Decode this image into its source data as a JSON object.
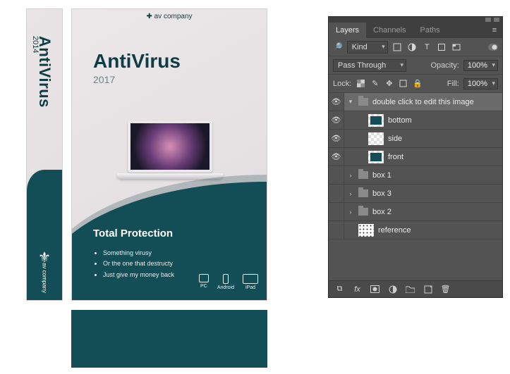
{
  "artboard": {
    "spine": {
      "title": "AntiVirus",
      "year": "2014",
      "company": "av company",
      "fleur": "⚜"
    },
    "front": {
      "brandline": "✚ av company",
      "title": "AntiVirus",
      "year": "2017",
      "tp_title": "Total Protection",
      "bullets": [
        "Something virusy",
        "Or the one that destructy",
        "Just give my money back"
      ],
      "platforms": [
        {
          "label": "PC",
          "shape": "pc"
        },
        {
          "label": "Android",
          "shape": "phone"
        },
        {
          "label": "iPad",
          "shape": "tab"
        }
      ]
    }
  },
  "panel": {
    "tabs": [
      "Layers",
      "Channels",
      "Paths"
    ],
    "active_tab": 0,
    "filter": {
      "kind_label": "Kind"
    },
    "blend": {
      "mode": "Pass Through",
      "opacity_label": "Opacity:",
      "opacity_value": "100%"
    },
    "lock": {
      "label": "Lock:",
      "fill_label": "Fill:",
      "fill_value": "100%"
    },
    "layers": [
      {
        "visible": true,
        "type": "group",
        "name": "double click to edit this image",
        "expanded": true,
        "selected": true,
        "depth": 0
      },
      {
        "visible": true,
        "type": "smart",
        "name": "bottom",
        "depth": 1,
        "thumb": "dark"
      },
      {
        "visible": true,
        "type": "smart",
        "name": "side",
        "depth": 1,
        "thumb": "ck"
      },
      {
        "visible": true,
        "type": "smart",
        "name": "front",
        "depth": 1,
        "thumb": "dark"
      },
      {
        "visible": false,
        "type": "group",
        "name": "box 1",
        "expanded": false,
        "depth": 0
      },
      {
        "visible": false,
        "type": "group",
        "name": "box 3",
        "expanded": false,
        "depth": 0
      },
      {
        "visible": false,
        "type": "group",
        "name": "box 2",
        "expanded": false,
        "depth": 0
      },
      {
        "visible": false,
        "type": "layer",
        "name": "reference",
        "depth": 0,
        "thumb": "ref"
      }
    ]
  }
}
